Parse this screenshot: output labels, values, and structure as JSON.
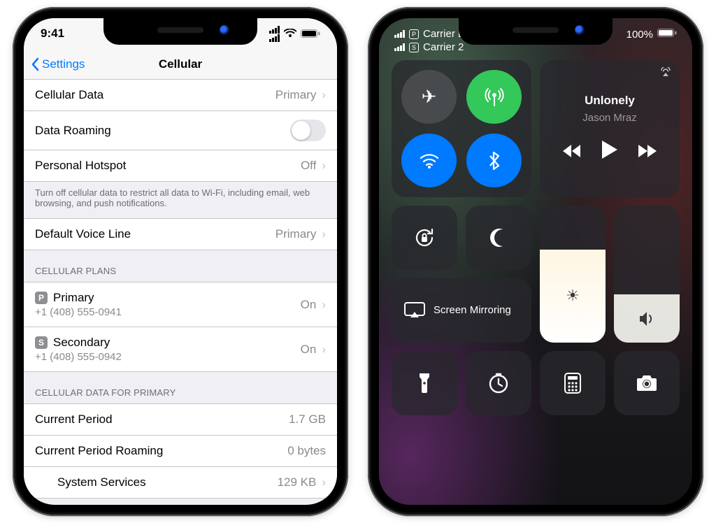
{
  "left": {
    "status_time": "9:41",
    "nav": {
      "back_label": "Settings",
      "title": "Cellular"
    },
    "cells": {
      "cellular_data": {
        "label": "Cellular Data",
        "value": "Primary"
      },
      "data_roaming": {
        "label": "Data Roaming",
        "on": false
      },
      "personal_hotspot": {
        "label": "Personal Hotspot",
        "value": "Off"
      },
      "default_voice": {
        "label": "Default Voice Line",
        "value": "Primary"
      }
    },
    "cell_data_note": "Turn off cellular data to restrict all data to Wi-Fi, including email, web browsing, and push notifications.",
    "sections": {
      "plans_header": "CELLULAR PLANS",
      "plans": [
        {
          "badge": "P",
          "name": "Primary",
          "number": "+1 (408) 555-0941",
          "state": "On"
        },
        {
          "badge": "S",
          "name": "Secondary",
          "number": "+1 (408) 555-0942",
          "state": "On"
        }
      ],
      "data_for_header": "CELLULAR DATA FOR PRIMARY",
      "usage": {
        "current_period": {
          "label": "Current Period",
          "value": "1.7 GB"
        },
        "current_period_roaming": {
          "label": "Current Period Roaming",
          "value": "0 bytes"
        },
        "system_services": {
          "label": "System Services",
          "value": "129 KB"
        }
      }
    }
  },
  "right": {
    "status": {
      "lines": [
        {
          "badge": "P",
          "text": "Carrier  LTE"
        },
        {
          "badge": "S",
          "text": "Carrier 2"
        }
      ],
      "battery": "100%"
    },
    "media": {
      "title": "Unlonely",
      "artist": "Jason Mraz"
    },
    "screen_mirroring": "Screen Mirroring"
  }
}
